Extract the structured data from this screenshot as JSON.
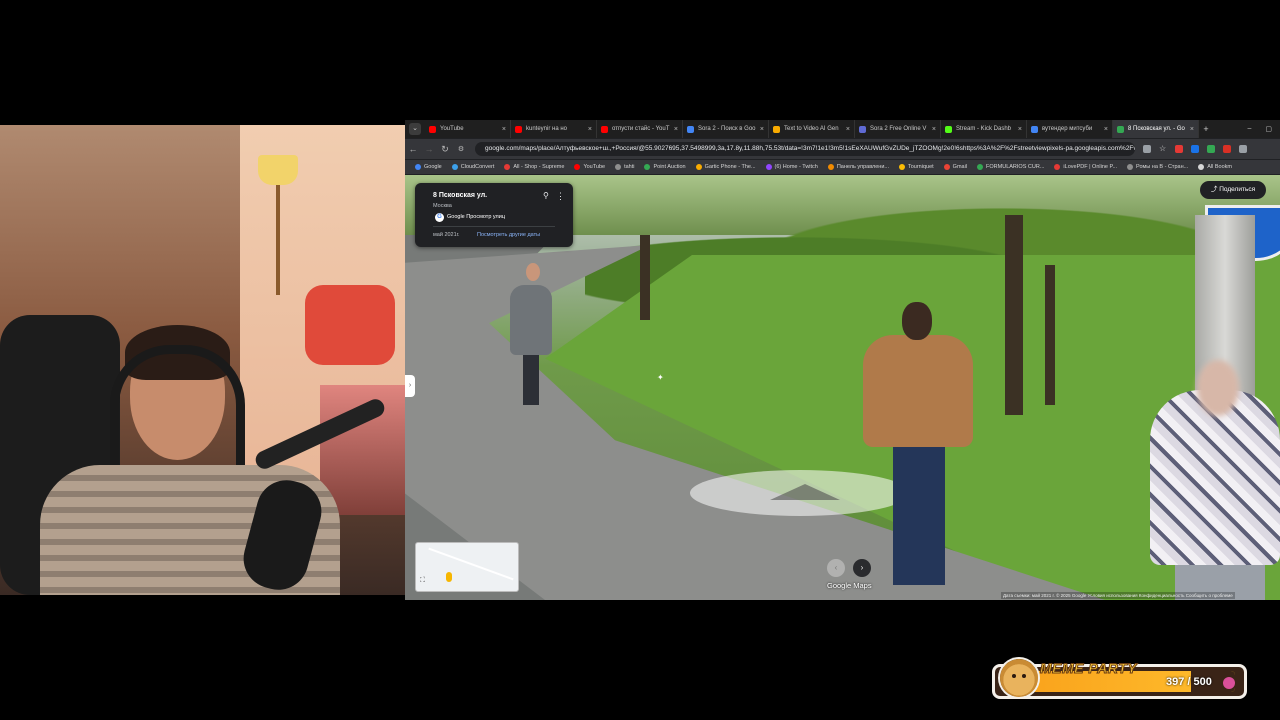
{
  "browser": {
    "tabs": [
      {
        "label": "YouTube",
        "color": "#ff0000",
        "active": false
      },
      {
        "label": "kunteynir на но",
        "color": "#ff0000",
        "active": false
      },
      {
        "label": "отпусти стайс - YouT",
        "color": "#ff0000",
        "active": false
      },
      {
        "label": "Sora 2 - Поиск в Goo",
        "color": "#4285f4",
        "active": false
      },
      {
        "label": "Text to Video AI Gen",
        "color": "#f9ab00",
        "active": false
      },
      {
        "label": "Sora 2 Free Online V",
        "color": "#5f6ad3",
        "active": false
      },
      {
        "label": "Stream - Kick Dashb",
        "color": "#53fc18",
        "active": false
      },
      {
        "label": "вутендер митсуби",
        "color": "#4285f4",
        "active": false
      },
      {
        "label": "8 Псковская ул. - Go",
        "color": "#34a853",
        "active": true
      }
    ],
    "url": "google.com/maps/place/Алтуфьевское+ш.,+Россия/@55.9027695,37.5498999,3a,17.8y,11.88h,75.53t/data=!3m7!1e1!3m5!1sEeXAUWufGvZUDe_jTZOOMg!2e0!6shttps%3A%2F%2Fstreetviewpixels-pa.googleapis.com%2Fv1...",
    "bookmarks": [
      {
        "label": "Google",
        "color": "#4285f4"
      },
      {
        "label": "CloudConvert",
        "color": "#3ca0ea"
      },
      {
        "label": "All - Shop - Supreme",
        "color": "#e53935"
      },
      {
        "label": "YouTube",
        "color": "#ff0000"
      },
      {
        "label": "tahti",
        "color": "#8e8e8e"
      },
      {
        "label": "Point Auction",
        "color": "#34a853"
      },
      {
        "label": "Gartic Phone - The...",
        "color": "#f9ab00"
      },
      {
        "label": "(6) Home - Twitch",
        "color": "#9146ff"
      },
      {
        "label": "Панель управлени...",
        "color": "#f28b00"
      },
      {
        "label": "Tourniquet",
        "color": "#fbbc04"
      },
      {
        "label": "Gmail",
        "color": "#ea4335"
      },
      {
        "label": "FORMULARIOS CUR...",
        "color": "#34a853"
      },
      {
        "label": "iLovePDF | Online P...",
        "color": "#e53935"
      },
      {
        "label": "Ромы на В - Стран...",
        "color": "#8e8e8e"
      },
      {
        "label": "All Bookm",
        "color": "#d6d6d6"
      }
    ]
  },
  "streetview": {
    "address": "8 Псковская ул.",
    "city": "Москва",
    "source": "Google Просмотр улиц",
    "date": "май 2021г.",
    "other_dates": "Посмотреть другие даты",
    "share": "Поделиться",
    "brand": "Google Maps",
    "footer": "Дата съемки: май 2021 г.   © 2025 Google    Условия использования    Конфиденциальность    Сообщить о проблеме"
  },
  "widget": {
    "title": "MEME PARTY",
    "current": 397,
    "max": 500,
    "count_text": "397 / 500"
  }
}
